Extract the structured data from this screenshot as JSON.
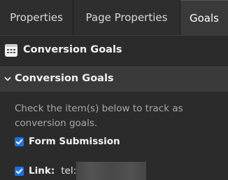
{
  "tabs": [
    {
      "label": "Properties"
    },
    {
      "label": "Page Properties"
    },
    {
      "label": "Goals"
    }
  ],
  "goals_header": {
    "title": "Conversion Goals",
    "icon": "calendar-icon"
  },
  "section": {
    "title": "Conversion Goals",
    "icon": "chevron-down-icon"
  },
  "description": "Check the item(s) below to track as conversion goals.",
  "items": [
    {
      "label": "Form Submission",
      "checked": true
    },
    {
      "label": "Link:",
      "value": "tel:",
      "checked": true
    }
  ],
  "colors": {
    "background": "#2b2b2b",
    "active_tab": "#3a3a3a",
    "checkbox": "#1a73e8"
  }
}
